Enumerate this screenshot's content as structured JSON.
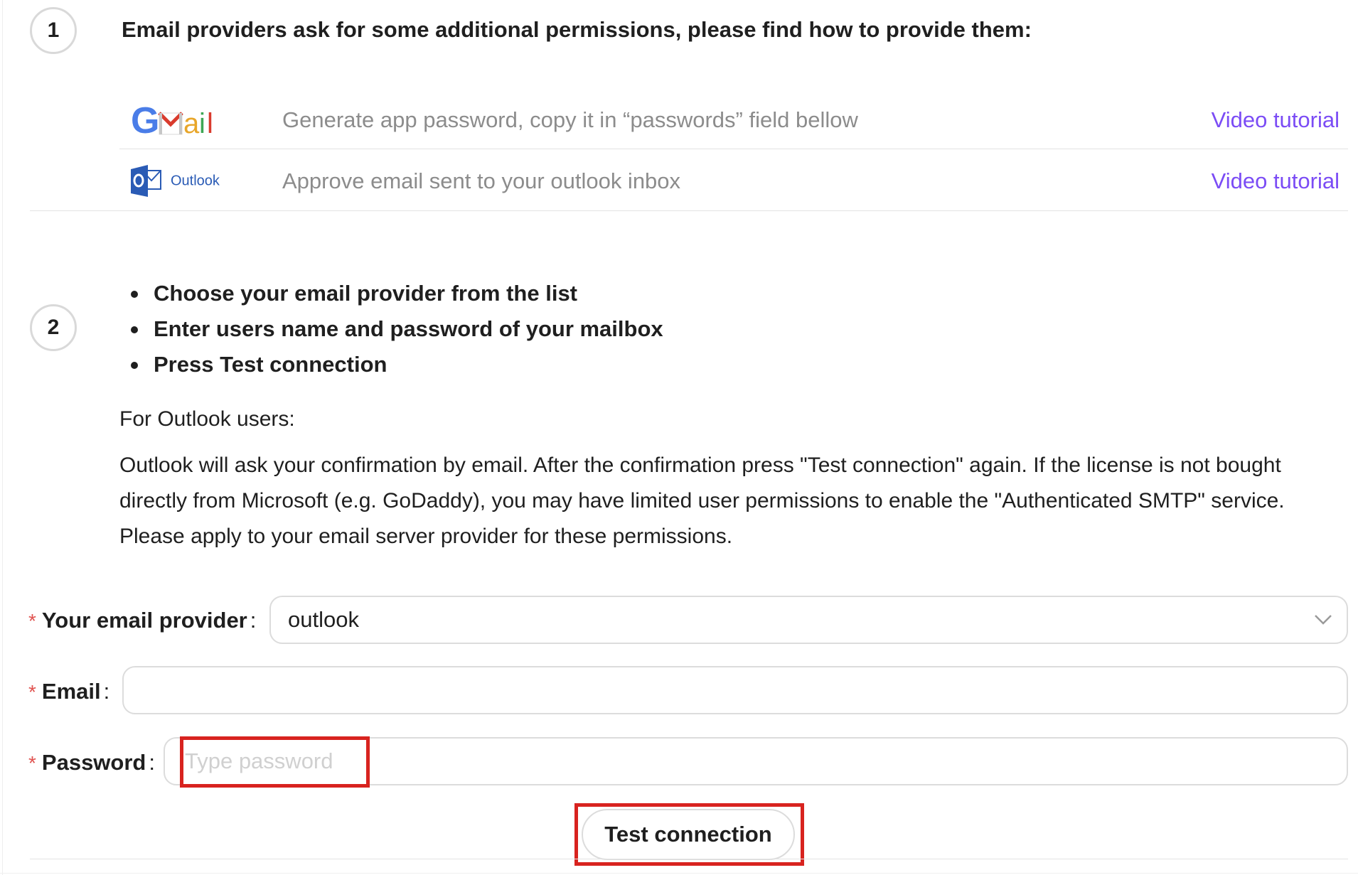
{
  "step1": {
    "number": "1",
    "heading": "Email providers ask for some additional permissions, please find how to provide them:",
    "providers": [
      {
        "name": "Gmail",
        "logo_text": "Gmail",
        "description": "Generate app password, copy it in “passwords” field bellow",
        "link_label": "Video tutorial"
      },
      {
        "name": "Outlook",
        "logo_text": "Outlook",
        "description": "Approve email sent to your outlook inbox",
        "link_label": "Video tutorial"
      }
    ]
  },
  "step2": {
    "number": "2",
    "bullets": [
      "Choose your email provider from the list",
      "Enter users name and password of your mailbox",
      "Press Test connection"
    ],
    "outlook_title": "For Outlook users:",
    "outlook_note": "Outlook will ask your confirmation by email. After the confirmation press \"Test connection\" again. If the license is not bought directly from Microsoft (e.g. GoDaddy), you may have limited user permissions to enable the \"Authenticated SMTP\" service. Please apply to your email server provider for these permissions."
  },
  "form": {
    "required_mark": "*",
    "colon": ":",
    "provider_label": "Your email provider",
    "provider_value": "outlook",
    "email_label": "Email",
    "email_value": "",
    "password_label": "Password",
    "password_placeholder": "Type password",
    "test_button_label": "Test connection"
  },
  "colors": {
    "link": "#7b4cf5",
    "required": "#e0524f",
    "highlight": "#d8231f"
  }
}
